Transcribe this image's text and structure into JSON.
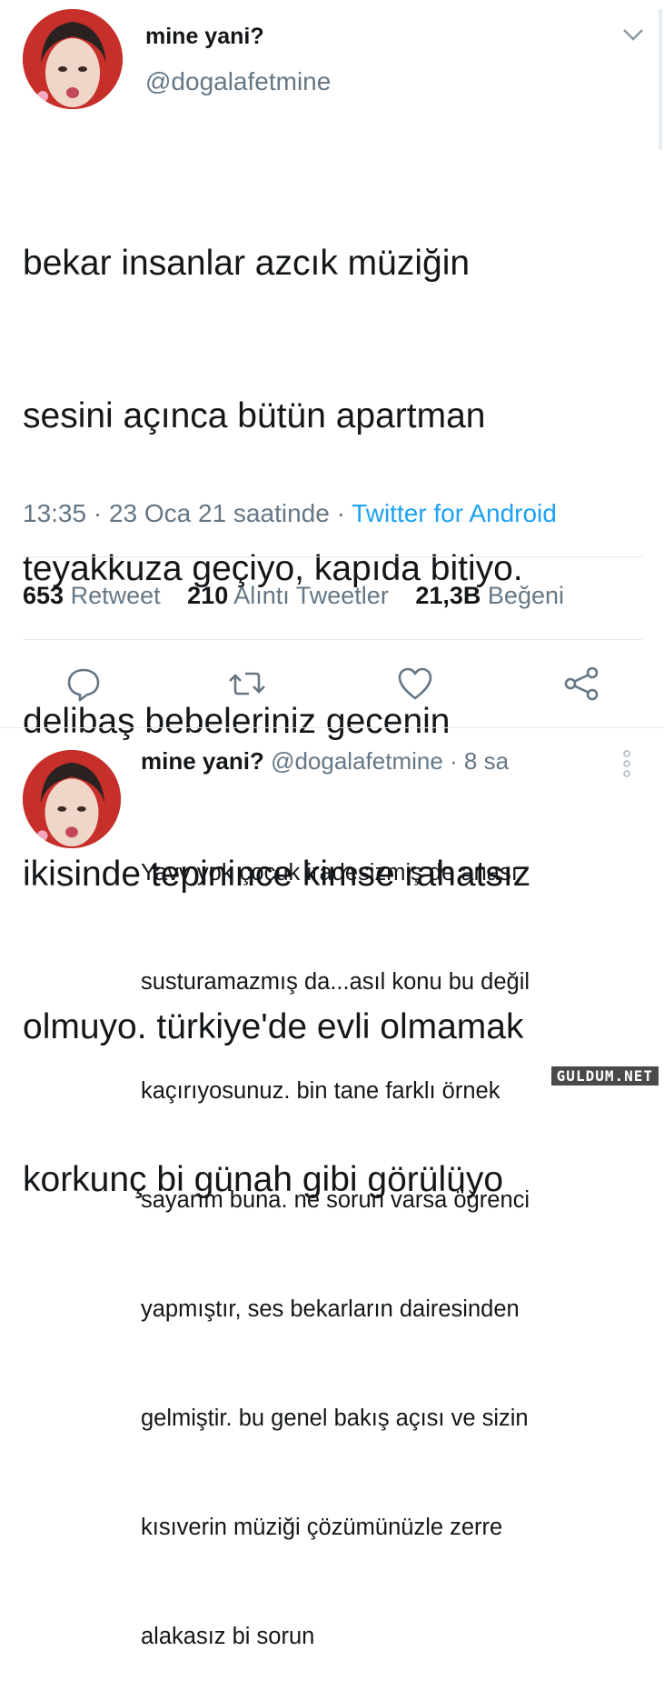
{
  "tweet": {
    "display_name": "mine yani?",
    "handle": "@dogalafetmine",
    "text_lines": [
      "bekar insanlar azcık müziğin",
      "sesini açınca bütün apartman",
      "teyakkuza geçiyo, kapıda bitiyo.",
      "delibaş bebeleriniz gecenin",
      "ikisinde tepinince kimse rahatsız",
      "olmuyo. türkiye'de evli olmamak",
      "korkunç bi günah gibi görülüyo"
    ],
    "timestamp": "13:35 · 23 Oca 21 saatinde · ",
    "client": "Twitter for Android",
    "stats": {
      "retweets_count": "653",
      "retweets_label": "Retweet",
      "quotes_count": "210",
      "quotes_label": "Alıntı Tweetler",
      "likes_count": "21,3B",
      "likes_label": "Beğeni"
    },
    "actions": [
      "reply-icon",
      "retweet-icon",
      "like-icon",
      "share-icon"
    ]
  },
  "reply": {
    "display_name": "mine yani?",
    "handle": "@dogalafetmine",
    "time": " · 8 sa",
    "text_lines": [
      "Yavv yok çocuk iradesizmiş de anası",
      "susturamazmış da...asıl konu bu değil",
      "kaçırıyosunuz. bin tane farklı örnek",
      "sayarım buna. ne sorun varsa öğrenci",
      "yapmıştır, ses bekarların dairesinden",
      "gelmiştir. bu genel bakış açısı ve sizin",
      "kısıverin müziği çözümünüzle zerre",
      "alakasız bi sorun"
    ]
  },
  "watermark": "GULDUM.NET",
  "colors": {
    "text": "#14171a",
    "secondary": "#657786",
    "accent": "#1da1f2",
    "divider": "#e1e8ed"
  }
}
